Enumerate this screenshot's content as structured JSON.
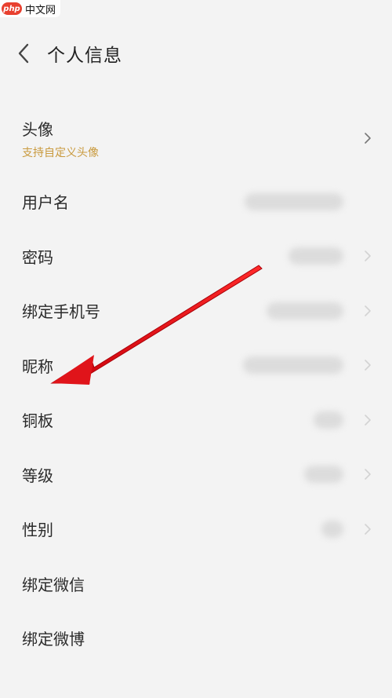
{
  "watermark": {
    "badge": "php",
    "text": "中文网"
  },
  "header": {
    "back_icon": "chevron-left-icon",
    "title": "个人信息"
  },
  "avatar": {
    "label": "头像",
    "subtitle": "支持自定义头像"
  },
  "items": [
    {
      "key": "username",
      "label": "用户名"
    },
    {
      "key": "password",
      "label": "密码"
    },
    {
      "key": "bind-phone",
      "label": "绑定手机号"
    },
    {
      "key": "nickname",
      "label": "昵称"
    },
    {
      "key": "copper",
      "label": "铜板"
    },
    {
      "key": "level",
      "label": "等级"
    },
    {
      "key": "gender",
      "label": "性别"
    },
    {
      "key": "bind-wechat",
      "label": "绑定微信"
    },
    {
      "key": "bind-weibo",
      "label": "绑定微博"
    }
  ],
  "colors": {
    "background": "#f3f3f3",
    "subtitle": "#c99a3e",
    "annotation_arrow": "#e0141a"
  }
}
